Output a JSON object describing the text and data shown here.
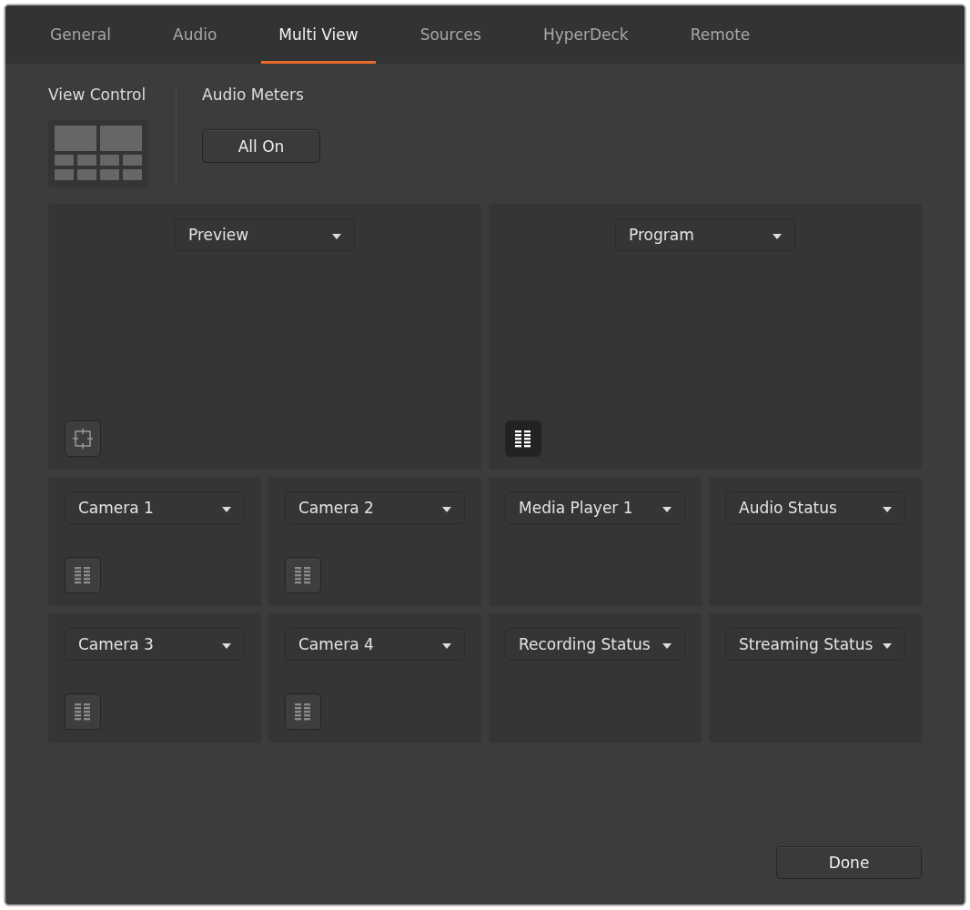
{
  "tabs": [
    {
      "label": "General",
      "selected": false
    },
    {
      "label": "Audio",
      "selected": false
    },
    {
      "label": "Multi View",
      "selected": true
    },
    {
      "label": "Sources",
      "selected": false
    },
    {
      "label": "HyperDeck",
      "selected": false
    },
    {
      "label": "Remote",
      "selected": false
    }
  ],
  "view_control": {
    "label": "View Control"
  },
  "audio_meters": {
    "label": "Audio Meters",
    "button": "All On"
  },
  "windows": [
    {
      "source": "Preview",
      "kind": "large",
      "toggle": {
        "kind": "safe_area",
        "on": false
      }
    },
    {
      "source": "Program",
      "kind": "large",
      "toggle": {
        "kind": "audio_meter",
        "on": true
      }
    },
    {
      "source": "Camera 1",
      "kind": "small",
      "toggle": {
        "kind": "audio_meter",
        "on": false
      }
    },
    {
      "source": "Camera 2",
      "kind": "small",
      "toggle": {
        "kind": "audio_meter",
        "on": false
      }
    },
    {
      "source": "Media Player 1",
      "kind": "small"
    },
    {
      "source": "Audio Status",
      "kind": "small"
    },
    {
      "source": "Camera 3",
      "kind": "small",
      "toggle": {
        "kind": "audio_meter",
        "on": false
      }
    },
    {
      "source": "Camera 4",
      "kind": "small",
      "toggle": {
        "kind": "audio_meter",
        "on": false
      }
    },
    {
      "source": "Recording Status",
      "kind": "small"
    },
    {
      "source": "Streaming Status",
      "kind": "small"
    }
  ],
  "done_button": "Done"
}
